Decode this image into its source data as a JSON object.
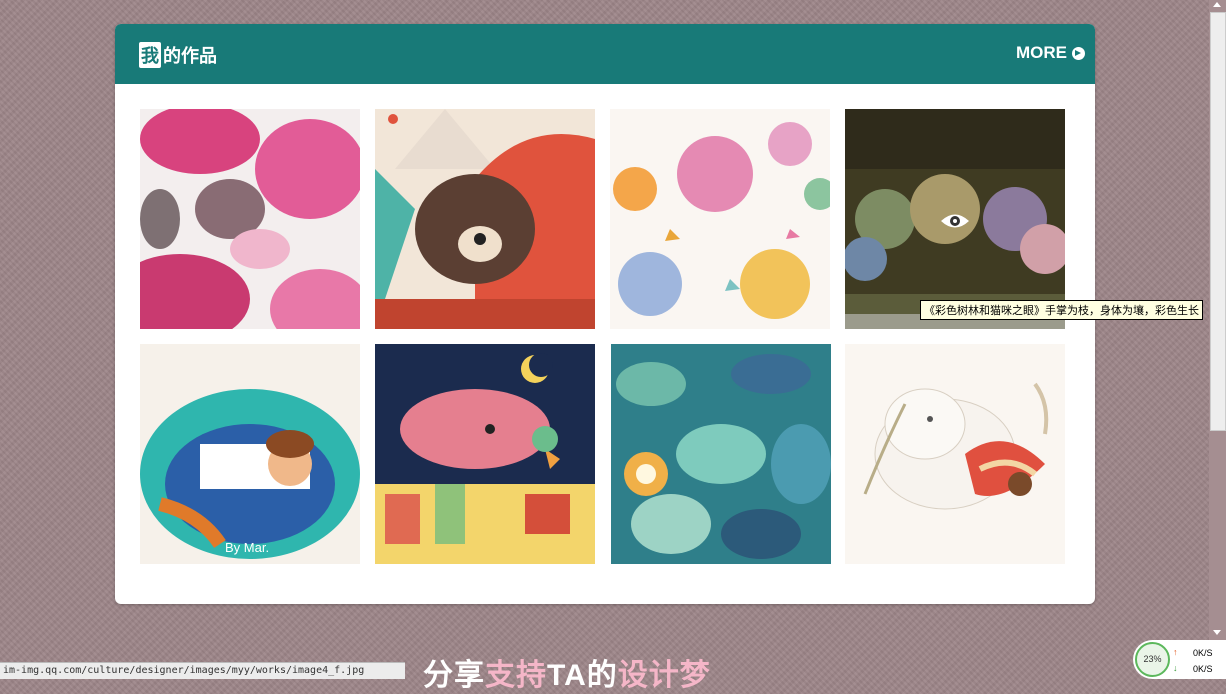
{
  "section": {
    "title_boxed": "我",
    "title_rest": "的作品",
    "more_label": "MORE"
  },
  "works": [
    {
      "alt": "pink leaves"
    },
    {
      "alt": "bear"
    },
    {
      "alt": "cats"
    },
    {
      "alt": "forest"
    },
    {
      "alt": "girl"
    },
    {
      "alt": "bird night town"
    },
    {
      "alt": "leaves mandala"
    },
    {
      "alt": "white bird"
    }
  ],
  "work5_signature": "By Mar.",
  "tooltip": "《彩色树林和猫咪之眼》手掌为枝，身体为壤，彩色生长",
  "status_url": "im-img.qq.com/culture/designer/images/myy/works/image4_f.jpg",
  "share_text_a": "分享",
  "share_text_b": "支持",
  "share_text_c": "TA的",
  "share_text_d": "设计梦",
  "net": {
    "percent": "23%",
    "up_speed": "0K/S",
    "down_speed": "0K/S",
    "up_icon": "arrow-up-icon",
    "down_icon": "arrow-down-icon"
  },
  "colors": {
    "header": "#187a78",
    "background": "#9d8588"
  }
}
